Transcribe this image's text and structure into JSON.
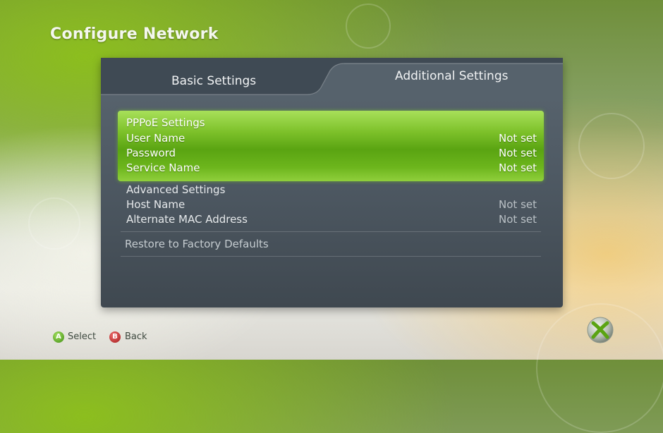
{
  "page": {
    "title": "Configure Network"
  },
  "tabs": [
    {
      "label": "Basic Settings",
      "selected": false
    },
    {
      "label": "Additional Settings",
      "selected": true
    }
  ],
  "pppoe": {
    "header": "PPPoE Settings",
    "items": [
      {
        "label": "User Name",
        "value": "Not set"
      },
      {
        "label": "Password",
        "value": "Not set"
      },
      {
        "label": "Service Name",
        "value": "Not set"
      }
    ]
  },
  "advanced": {
    "header": "Advanced Settings",
    "items": [
      {
        "label": "Host Name",
        "value": "Not set"
      },
      {
        "label": "Alternate MAC Address",
        "value": "Not set"
      }
    ]
  },
  "restore_label": "Restore to Factory Defaults",
  "footer": {
    "select": {
      "glyph": "A",
      "label": "Select",
      "color": "#5aa412"
    },
    "back": {
      "glyph": "B",
      "label": "Back",
      "color": "#c02020"
    }
  },
  "colors": {
    "accent": "#7dc12a",
    "panel": "#4f5a64"
  },
  "icons": {
    "logo": "xbox-logo-icon"
  }
}
